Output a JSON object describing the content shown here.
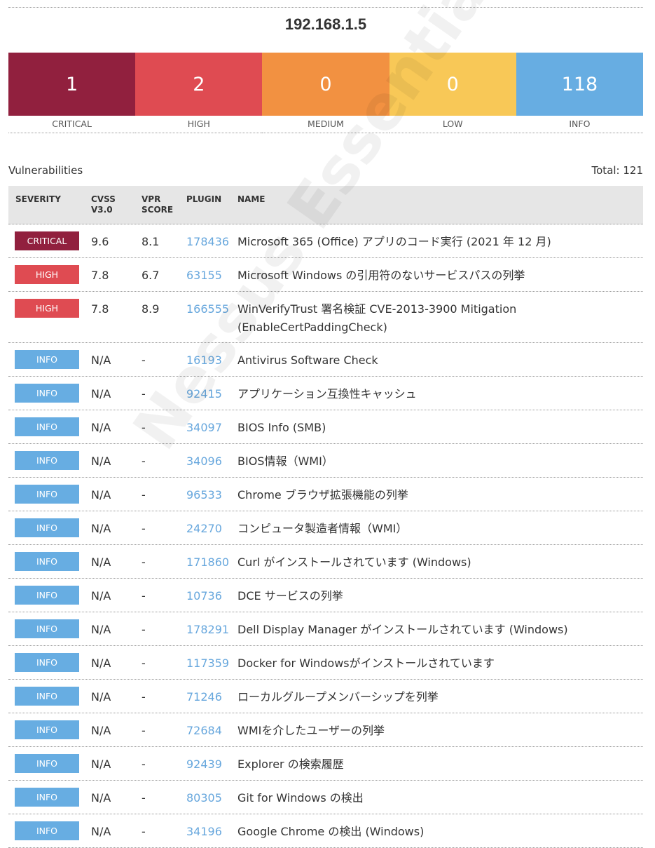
{
  "host": "192.168.1.5",
  "summary": [
    {
      "count": "1",
      "label": "CRITICAL",
      "color": "#91203e"
    },
    {
      "count": "2",
      "label": "HIGH",
      "color": "#df4b52"
    },
    {
      "count": "0",
      "label": "MEDIUM",
      "color": "#f29141"
    },
    {
      "count": "0",
      "label": "LOW",
      "color": "#f8c857"
    },
    {
      "count": "118",
      "label": "INFO",
      "color": "#67ade2"
    }
  ],
  "section": {
    "title": "Vulnerabilities",
    "total": "Total: 121"
  },
  "columns": {
    "severity": "SEVERITY",
    "cvss_line1": "CVSS",
    "cvss_line2": "V3.0",
    "vpr_line1": "VPR",
    "vpr_line2": "SCORE",
    "plugin": "PLUGIN",
    "name": "NAME"
  },
  "rows": [
    {
      "severity": "CRITICAL",
      "color": "#91203e",
      "cvss": "9.6",
      "vpr": "8.1",
      "plugin": "178436",
      "name": "Microsoft 365 (Office) アプリのコード実行 (2021 年 12 月)"
    },
    {
      "severity": "HIGH",
      "color": "#df4b52",
      "cvss": "7.8",
      "vpr": "6.7",
      "plugin": "63155",
      "name": "Microsoft Windows の引用符のないサービスパスの列挙"
    },
    {
      "severity": "HIGH",
      "color": "#df4b52",
      "cvss": "7.8",
      "vpr": "8.9",
      "plugin": "166555",
      "name": "WinVerifyTrust 署名検証 CVE-2013-3900 Mitigation (EnableCertPaddingCheck)"
    },
    {
      "severity": "INFO",
      "color": "#67ade2",
      "cvss": "N/A",
      "vpr": "-",
      "plugin": "16193",
      "name": "Antivirus Software Check"
    },
    {
      "severity": "INFO",
      "color": "#67ade2",
      "cvss": "N/A",
      "vpr": "-",
      "plugin": "92415",
      "name": "アプリケーション互換性キャッシュ"
    },
    {
      "severity": "INFO",
      "color": "#67ade2",
      "cvss": "N/A",
      "vpr": "-",
      "plugin": "34097",
      "name": "BIOS Info (SMB)"
    },
    {
      "severity": "INFO",
      "color": "#67ade2",
      "cvss": "N/A",
      "vpr": "-",
      "plugin": "34096",
      "name": "BIOS情報（WMI）"
    },
    {
      "severity": "INFO",
      "color": "#67ade2",
      "cvss": "N/A",
      "vpr": "-",
      "plugin": "96533",
      "name": "Chrome ブラウザ拡張機能の列挙"
    },
    {
      "severity": "INFO",
      "color": "#67ade2",
      "cvss": "N/A",
      "vpr": "-",
      "plugin": "24270",
      "name": "コンピュータ製造者情報（WMI）"
    },
    {
      "severity": "INFO",
      "color": "#67ade2",
      "cvss": "N/A",
      "vpr": "-",
      "plugin": "171860",
      "name": "Curl がインストールされています (Windows)"
    },
    {
      "severity": "INFO",
      "color": "#67ade2",
      "cvss": "N/A",
      "vpr": "-",
      "plugin": "10736",
      "name": "DCE サービスの列挙"
    },
    {
      "severity": "INFO",
      "color": "#67ade2",
      "cvss": "N/A",
      "vpr": "-",
      "plugin": "178291",
      "name": "Dell Display Manager がインストールされています (Windows)"
    },
    {
      "severity": "INFO",
      "color": "#67ade2",
      "cvss": "N/A",
      "vpr": "-",
      "plugin": "117359",
      "name": "Docker for Windowsがインストールされています"
    },
    {
      "severity": "INFO",
      "color": "#67ade2",
      "cvss": "N/A",
      "vpr": "-",
      "plugin": "71246",
      "name": "ローカルグループメンバーシップを列挙"
    },
    {
      "severity": "INFO",
      "color": "#67ade2",
      "cvss": "N/A",
      "vpr": "-",
      "plugin": "72684",
      "name": "WMIを介したユーザーの列挙"
    },
    {
      "severity": "INFO",
      "color": "#67ade2",
      "cvss": "N/A",
      "vpr": "-",
      "plugin": "92439",
      "name": "Explorer の検索履歴"
    },
    {
      "severity": "INFO",
      "color": "#67ade2",
      "cvss": "N/A",
      "vpr": "-",
      "plugin": "80305",
      "name": "Git for Windows の検出"
    },
    {
      "severity": "INFO",
      "color": "#67ade2",
      "cvss": "N/A",
      "vpr": "-",
      "plugin": "34196",
      "name": "Google Chrome の検出 (Windows)"
    }
  ],
  "watermark": "Nessus Essentials"
}
